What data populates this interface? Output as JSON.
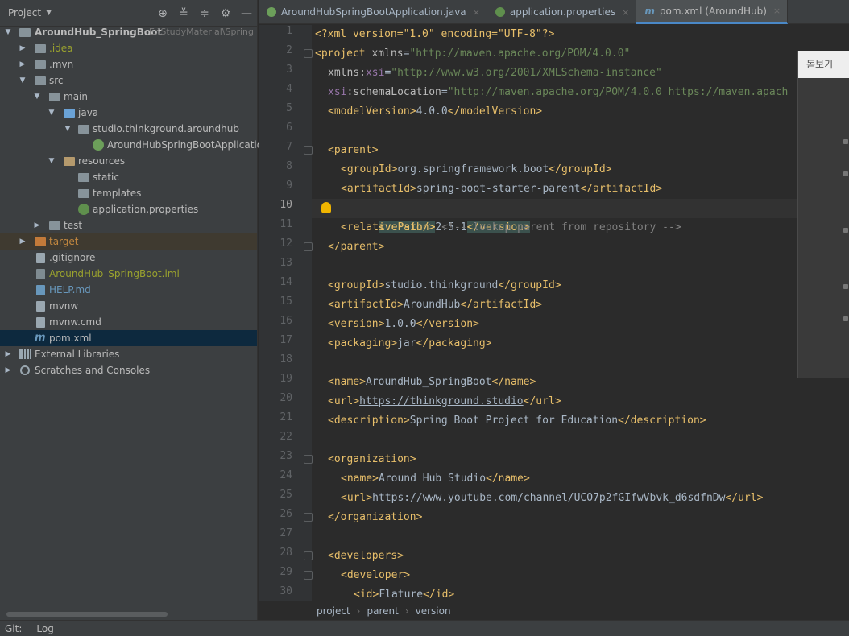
{
  "project": {
    "title": "Project",
    "tree": [
      {
        "label": "AroundHub_SpringBoot",
        "hint": "E:\\StudyMaterial\\Spring"
      },
      {
        "label": ".idea"
      },
      {
        "label": ".mvn"
      },
      {
        "label": "src"
      },
      {
        "label": "main"
      },
      {
        "label": "java"
      },
      {
        "label": "studio.thinkground.aroundhub"
      },
      {
        "label": "AroundHubSpringBootApplication"
      },
      {
        "label": "resources"
      },
      {
        "label": "static"
      },
      {
        "label": "templates"
      },
      {
        "label": "application.properties"
      },
      {
        "label": "test"
      },
      {
        "label": "target"
      },
      {
        "label": ".gitignore"
      },
      {
        "label": "AroundHub_SpringBoot.iml"
      },
      {
        "label": "HELP.md"
      },
      {
        "label": "mvnw"
      },
      {
        "label": "mvnw.cmd"
      },
      {
        "label": "pom.xml"
      },
      {
        "label": "External Libraries"
      },
      {
        "label": "Scratches and Consoles"
      }
    ]
  },
  "tabs": [
    {
      "label": "AroundHubSpringBootApplication.java",
      "close": "×"
    },
    {
      "label": "application.properties",
      "close": "×"
    },
    {
      "label": "pom.xml (AroundHub)",
      "close": "×"
    }
  ],
  "editor": {
    "current_line": 10,
    "line_numbers": [
      "1",
      "2",
      "3",
      "4",
      "5",
      "6",
      "7",
      "8",
      "9",
      "10",
      "11",
      "12",
      "13",
      "14",
      "15",
      "16",
      "17",
      "18",
      "19",
      "20",
      "21",
      "22",
      "23",
      "24",
      "25",
      "26",
      "27",
      "28",
      "29",
      "30"
    ]
  },
  "code": {
    "l1": {
      "decl": "<?xml version=\"1.0\" encoding=\"UTF-8\"?>"
    },
    "l2": {
      "open": "<project ",
      "attr": "xmlns",
      "eq": "=",
      "val": "\"http://maven.apache.org/POM/4.0.0\""
    },
    "l3": {
      "ns": "xmlns:",
      "attr": "xsi",
      "eq": "=",
      "val": "\"http://www.w3.org/2001/XMLSchema-instance\""
    },
    "l4": {
      "ns": "xsi",
      "attr": ":schemaLocation",
      "eq": "=",
      "val": "\"http://maven.apache.org/POM/4.0.0 https://maven.apach"
    },
    "l5": {
      "open": "<modelVersion>",
      "text": "4.0.0",
      "close": "</modelVersion>"
    },
    "l7": {
      "open": "<parent>"
    },
    "l8": {
      "open": "<groupId>",
      "text": "org.springframework.boot",
      "close": "</groupId>"
    },
    "l9": {
      "open": "<artifactId>",
      "text": "spring-boot-starter-parent",
      "close": "</artifactId>"
    },
    "l10": {
      "open": "<version>",
      "text": "2.5.1",
      "close": "</version>"
    },
    "l11": {
      "open": "<relativePath/>",
      "comment": " <!-- lookup parent from repository -->"
    },
    "l12": {
      "close": "</parent>"
    },
    "l14": {
      "open": "<groupId>",
      "text": "studio.thinkground",
      "close": "</groupId>"
    },
    "l15": {
      "open": "<artifactId>",
      "text": "AroundHub",
      "close": "</artifactId>"
    },
    "l16": {
      "open": "<version>",
      "text": "1.0.0",
      "close": "</version>"
    },
    "l17": {
      "open": "<packaging>",
      "text": "jar",
      "close": "</packaging>"
    },
    "l19": {
      "open": "<name>",
      "text": "AroundHub_SpringBoot",
      "close": "</name>"
    },
    "l20": {
      "open": "<url>",
      "text": "https://thinkground.studio",
      "close": "</url>"
    },
    "l21": {
      "open": "<description>",
      "text": "Spring Boot Project for Education",
      "close": "</description>"
    },
    "l23": {
      "open": "<organization>"
    },
    "l24": {
      "open": "<name>",
      "text": "Around Hub Studio",
      "close": "</name>"
    },
    "l25": {
      "open": "<url>",
      "text": "https://www.youtube.com/channel/UCO7p2fGIfwVbvk_d6sdfnDw",
      "close": "</url>"
    },
    "l26": {
      "close": "</organization>"
    },
    "l28": {
      "open": "<developers>"
    },
    "l29": {
      "open": "<developer>"
    },
    "l30": {
      "open": "<id>",
      "text": "Flature",
      "close": "</id>"
    }
  },
  "breadcrumb": [
    "project",
    "parent",
    "version"
  ],
  "breadcrumb_sep": "›",
  "status": {
    "git": "Git:",
    "log": "Log"
  },
  "overlay": {
    "title": "돋보기"
  },
  "colors": {
    "tag": "#e8bf6a",
    "value": "#6a8759",
    "namespace": "#9876aa",
    "comment": "#808080",
    "selection": "#0d293e",
    "accent": "#4a88c7"
  }
}
